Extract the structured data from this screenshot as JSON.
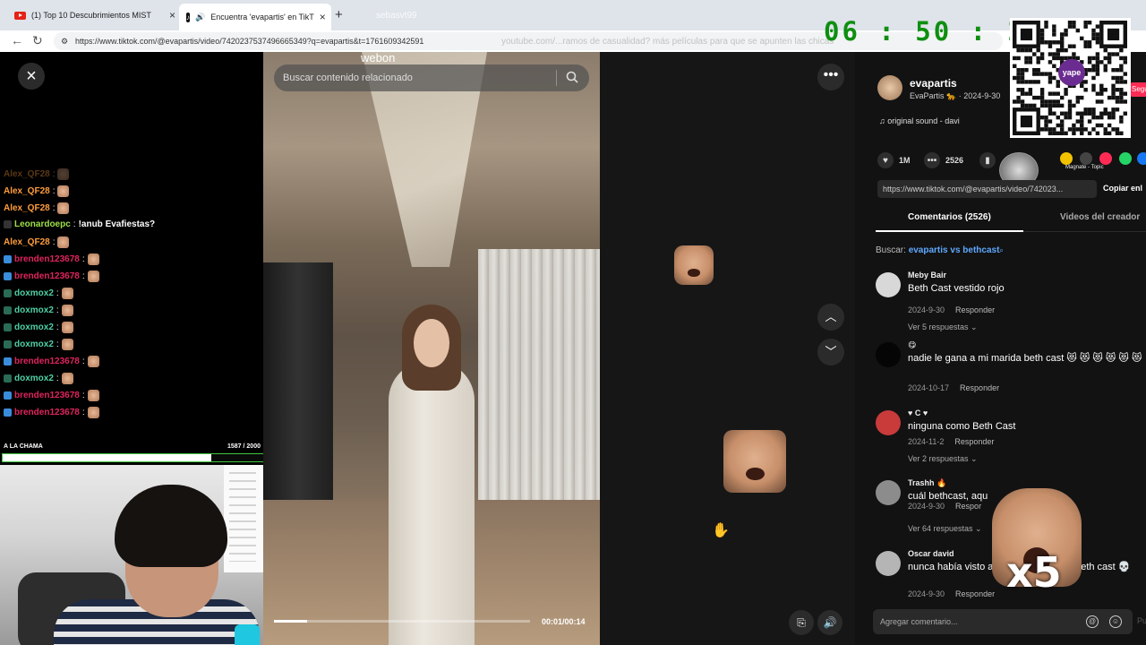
{
  "browser": {
    "tabs": [
      {
        "title": "(1) Top 10 Descubrimientos MIST"
      },
      {
        "title": "Encuentra 'evapartis' en TikT"
      }
    ],
    "ghost_tab": "sebasvt99",
    "url": "https://www.tiktok.com/@evapartis/video/7420237537496665349?q=evapartis&t=1761609342591",
    "url_ghost": "youtube.com/...ramos de casualidad? más películas para que se apunten las chicas"
  },
  "timer": "06 : 50 : 12",
  "video": {
    "search_placeholder": "Buscar contenido relacionado",
    "overlay_text": "webon",
    "time": "00:01/00:14",
    "progress": 0.13
  },
  "tiktok": {
    "username": "evapartis",
    "subname": "EvaPartis 🐆 · 2024-9-30",
    "follow_label": "Segui",
    "sound": "♫  original sound - davi",
    "likes": "1M",
    "comments_count": "2526",
    "link": "https://www.tiktok.com/@evapartis/video/742023...",
    "copy_label": "Copiar enl",
    "tabs": {
      "comments": "Comentarios (2526)",
      "creator": "Videos del creador"
    },
    "search_prefix": "Buscar:",
    "search_term": "evapartis vs bethcast",
    "overlay_song": "Magnate - Topic",
    "comments": [
      {
        "name": "Meby Bair",
        "text": "Beth Cast vestido rojo",
        "date": "2024-9-30",
        "reply": "Responder",
        "replies": "Ver 5 respuestas ⌄",
        "color": "#d8d8d8"
      },
      {
        "name": "😋",
        "text": "nadie le gana a mi marida beth cast 😻 😻 😻 😻 😻 😻",
        "date": "2024-10-17",
        "reply": "Responder",
        "replies": "",
        "color": "#050505"
      },
      {
        "name": "♥ C ♥",
        "text": "ninguna como Beth Cast",
        "date": "2024-11-2",
        "reply": "Responder",
        "replies": "Ver 2 respuestas ⌄",
        "color": "#c93a3a"
      },
      {
        "name": "Trashh 🔥",
        "text": "cuál bethcast, aqu",
        "date": "2024-9-30",
        "reply": "Respor",
        "replies": "Ver 64 respuestas ⌄",
        "color": "#8c8c8c"
      },
      {
        "name": "Oscar david",
        "text": "nunca había visto a · · · ciera frente a Beth cast 💀",
        "date": "2024-9-30",
        "reply": "Responder",
        "replies": "",
        "color": "#b5b5b5"
      }
    ],
    "comment_placeholder": "Agregar comentario...",
    "post_label": "Pu"
  },
  "chat": {
    "lines": [
      {
        "user": "Alex_QF28",
        "color": "#ff9d3c",
        "msg": "",
        "emote": true,
        "faded": true
      },
      {
        "user": "Alex_QF28",
        "color": "#ff9d3c",
        "msg": "",
        "emote": true
      },
      {
        "user": "Alex_QF28",
        "color": "#ff9d3c",
        "msg": "",
        "emote": true
      },
      {
        "user": "Leonardoepc",
        "color": "#9fe04a",
        "msg": "!anub Evafiestas?",
        "emote": false
      },
      {
        "user": "Alex_QF28",
        "color": "#ff9d3c",
        "msg": "",
        "emote": true
      },
      {
        "user": "brenden123678",
        "color": "#e0245e",
        "msg": "",
        "emote": true
      },
      {
        "user": "brenden123678",
        "color": "#e0245e",
        "msg": "",
        "emote": true
      },
      {
        "user": "doxmox2",
        "color": "#4fd1a5",
        "msg": "",
        "emote": true
      },
      {
        "user": "doxmox2",
        "color": "#4fd1a5",
        "msg": "",
        "emote": true
      },
      {
        "user": "doxmox2",
        "color": "#4fd1a5",
        "msg": "",
        "emote": true
      },
      {
        "user": "doxmox2",
        "color": "#4fd1a5",
        "msg": "",
        "emote": true
      },
      {
        "user": "brenden123678",
        "color": "#e0245e",
        "msg": "",
        "emote": true
      },
      {
        "user": "doxmox2",
        "color": "#4fd1a5",
        "msg": "",
        "emote": true
      },
      {
        "user": "brenden123678",
        "color": "#e0245e",
        "msg": "",
        "emote": true
      },
      {
        "user": "brenden123678",
        "color": "#e0245e",
        "msg": "",
        "emote": true
      }
    ],
    "goal_label": "A LA CHAMA",
    "goal_count": "1587 / 2000",
    "goal_progress": 0.7935
  },
  "overlay_multiplier": "x5",
  "colors": {
    "accent": "#fe2c55",
    "timer": "#0e8f10",
    "goal": "#3ec43e",
    "link": "#5fa8ff"
  }
}
